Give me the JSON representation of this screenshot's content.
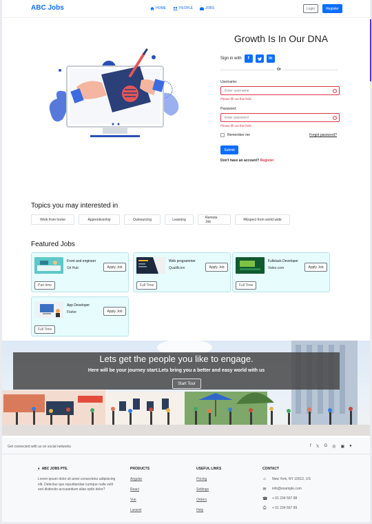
{
  "nav": {
    "brand": "ABC Jobs",
    "links": [
      {
        "label": "HOME",
        "icon": "home-icon"
      },
      {
        "label": "PEOPLE",
        "icon": "people-icon"
      },
      {
        "label": "JOBS",
        "icon": "briefcase-icon"
      }
    ],
    "login_label": "Login",
    "register_label": "Register"
  },
  "login": {
    "title": "Growth Is In Our DNA",
    "signin_label": "Sign in with",
    "social": [
      "f",
      "t",
      "in"
    ],
    "or_label": "Or",
    "username_label": "Username:",
    "username_placeholder": "Enter username",
    "username_error": "Please fill out this field.",
    "password_label": "Password:",
    "password_placeholder": "Enter password",
    "password_error": "Please fill out this field.",
    "remember_label": "Remember me",
    "forgot_label": "Forgot password?",
    "submit_label": "Submit",
    "no_account_text": "Don't have an account?",
    "register_link": "Register"
  },
  "topics": {
    "title": "Topics you may interested in",
    "items": [
      "Work from home",
      "Apprenticeship",
      "Outsourcing",
      "Learning",
      "Remote Job",
      "REspect from world wide"
    ]
  },
  "featured": {
    "title": "Featured Jobs",
    "jobs": [
      {
        "title": "Front and engineer",
        "company": "Git Hub",
        "apply": "Apply Job",
        "type": "Part time"
      },
      {
        "title": "Web programmer",
        "company": "Qualificion",
        "apply": "Apply Job",
        "type": "Full Time"
      },
      {
        "title": "Fullstack Developer",
        "company": "Valeo.com",
        "apply": "Apply Job",
        "type": "Full Time"
      },
      {
        "title": "App Developer",
        "company": "Flatter",
        "apply": "Apply Job",
        "type": "Full Time"
      }
    ]
  },
  "banner": {
    "title": "Lets get the people you like to engage.",
    "subtitle": "Here will be your journey start.Lets bring you a better and easy world with us",
    "button": "Start Tour"
  },
  "footer": {
    "connect": "Get connected with us on social networks",
    "social_icons": [
      "facebook-icon",
      "twitter-icon",
      "google-icon",
      "instagram-icon",
      "linkedin-icon",
      "github-icon"
    ],
    "company_name": "ABC JOBS PTE.",
    "company_text": "Lorem ipsum dolor sit amet consectetur adipisicing elit. Delectus quo repudiandae cumque nulla velit sed distinctio accusantium alias optio dolor?",
    "products_title": "PRODUCTS",
    "products": [
      "Angular",
      "React",
      "Vue",
      "Laravel"
    ],
    "useful_title": "USEFUL LINKS",
    "useful": [
      "Pricing",
      "Settings",
      "Orders",
      "Help"
    ],
    "contact_title": "CONTACT",
    "contact": [
      {
        "icon": "home-icon",
        "text": "New York, NY 10012, US"
      },
      {
        "icon": "envelope-icon",
        "text": "info@example.com"
      },
      {
        "icon": "phone-icon",
        "text": "+ 01 234 567 88"
      },
      {
        "icon": "printer-icon",
        "text": "+ 01 234 567 89"
      }
    ]
  },
  "colors": {
    "primary": "#0d6efd",
    "danger": "#dc3545",
    "card_bg": "#e6fcfd"
  }
}
